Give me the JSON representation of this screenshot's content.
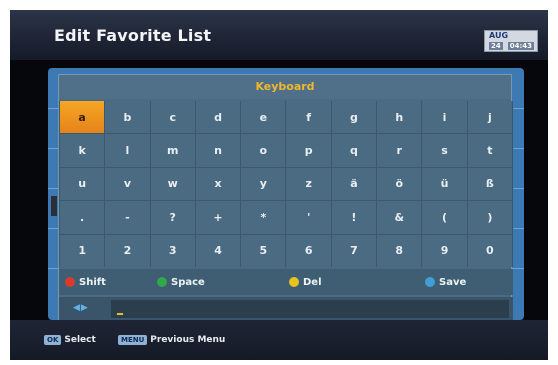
{
  "header": {
    "title": "Edit Favorite List",
    "date": {
      "month": "AUG",
      "day": "24",
      "time": "04:43"
    }
  },
  "keyboard": {
    "title": "Keyboard",
    "selected": "a",
    "rows": [
      [
        "a",
        "b",
        "c",
        "d",
        "e",
        "f",
        "g",
        "h",
        "i",
        "j"
      ],
      [
        "k",
        "l",
        "m",
        "n",
        "o",
        "p",
        "q",
        "r",
        "s",
        "t"
      ],
      [
        "u",
        "v",
        "w",
        "x",
        "y",
        "z",
        "ä",
        "ö",
        "ü",
        "ß"
      ],
      [
        ".",
        "-",
        "?",
        "+",
        "*",
        "'",
        "!",
        "&",
        "(",
        ")"
      ],
      [
        "1",
        "2",
        "3",
        "4",
        "5",
        "6",
        "7",
        "8",
        "9",
        "0"
      ]
    ]
  },
  "legend": {
    "shift": {
      "label": "Shift",
      "color": "#d83a2e"
    },
    "space": {
      "label": "Space",
      "color": "#33a84a"
    },
    "del": {
      "label": "Del",
      "color": "#e8c21e"
    },
    "save": {
      "label": "Save",
      "color": "#3f9fd6"
    }
  },
  "input": {
    "pointer_icon": "rewind-forward-icon",
    "value": ""
  },
  "footer": {
    "select": {
      "key": "OK",
      "label": "Select"
    },
    "menu": {
      "key": "MENU",
      "label": "Previous Menu"
    }
  }
}
